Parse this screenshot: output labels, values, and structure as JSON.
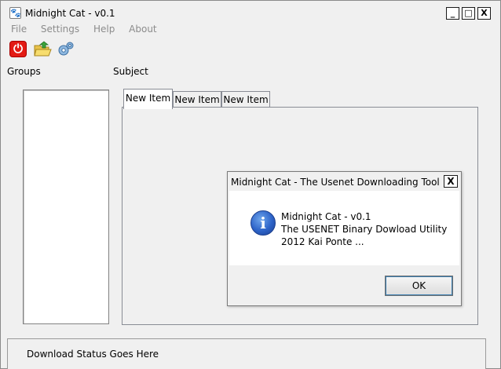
{
  "window": {
    "title": "Midnight Cat  - v0.1",
    "minimize": "_",
    "maximize": "□",
    "close": "X"
  },
  "menu": [
    "File",
    "Settings",
    "Help",
    "About"
  ],
  "toolbar": {
    "power_icon": "power-icon",
    "open_icon": "folder-open-icon",
    "settings_icon": "gear-icon"
  },
  "labels": {
    "groups": "Groups",
    "subject": "Subject"
  },
  "tabs": [
    {
      "label": "New Item",
      "active": true
    },
    {
      "label": "New Item",
      "active": false
    },
    {
      "label": "New Item",
      "active": false
    }
  ],
  "dialog": {
    "title": "Midnight Cat - The Usenet Downloading Tool",
    "close": "X",
    "icon": "info-icon",
    "message_lines": [
      "Midnight Cat - v0.1",
      " The USENET Binary Dowload Utility",
      " 2012 Kai Ponte ..."
    ],
    "ok": "OK"
  },
  "status": {
    "text": "Download Status Goes Here"
  },
  "colors": {
    "background": "#f0f0f0",
    "power_red": "#e31b14",
    "info_blue": "#2d63c8",
    "disabled_text": "#8c8c8c"
  }
}
